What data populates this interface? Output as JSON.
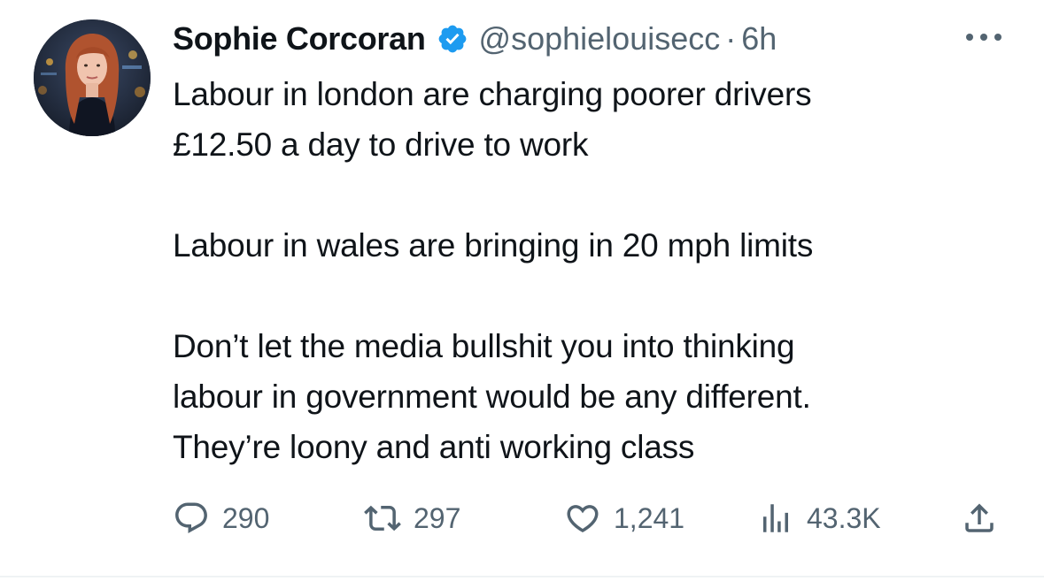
{
  "author": {
    "display_name": "Sophie Corcoran",
    "handle": "@sophielouisecc",
    "separator": "·",
    "time": "6h",
    "verified": true,
    "verified_color": "#1d9bf0"
  },
  "tweet": {
    "lines": [
      "Labour in london are charging poorer drivers",
      "£12.50 a day to drive to work",
      "",
      "Labour in wales are bringing in 20 mph limits",
      "",
      "Don’t let the media bullshit you into thinking",
      "labour in government would be any different.",
      "They’re loony and anti working class"
    ]
  },
  "actions": {
    "replies": "290",
    "retweets": "297",
    "likes": "1,241",
    "views": "43.3K",
    "icons": {
      "reply": "reply-icon",
      "retweet": "retweet-icon",
      "like": "heart-icon",
      "views": "views-icon",
      "share": "share-icon",
      "more": "more-icon"
    }
  },
  "colors": {
    "text_primary": "#0f1419",
    "text_secondary": "#536471",
    "accent": "#1d9bf0"
  }
}
